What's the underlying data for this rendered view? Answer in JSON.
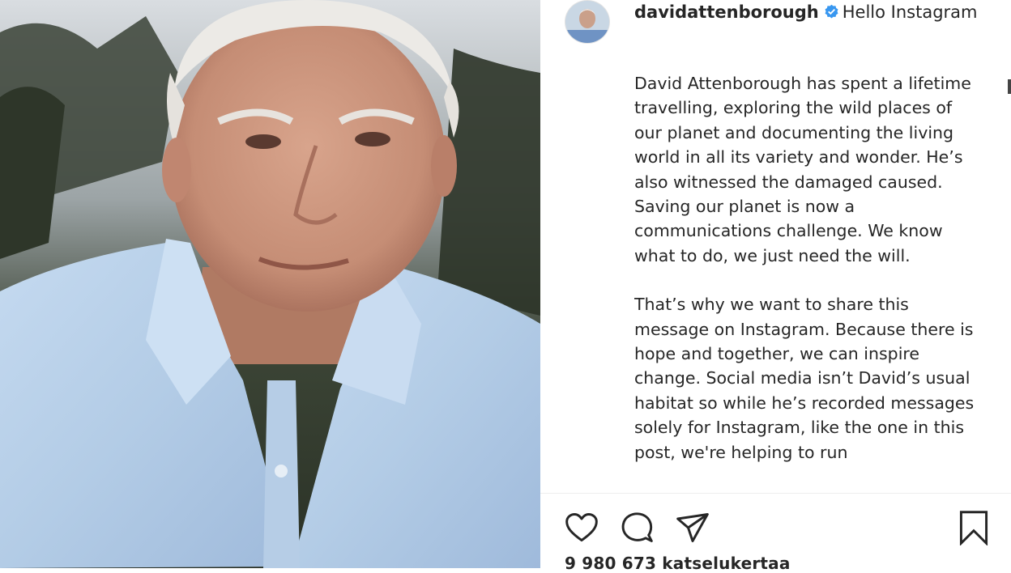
{
  "post": {
    "username": "davidattenborough",
    "header_text": "Hello Instagram",
    "caption_paragraphs": [
      "David Attenborough has spent a lifetime travelling, exploring the wild places of our planet and documenting the living world in all its variety and wonder. He’s also witnessed the damaged caused. Saving our planet is now a communications challenge. We know what to do, we just need the will.",
      "That’s why we want to share this message on Instagram. Because there is hope and together, we can inspire change. Social media isn’t David’s usual habitat so while he’s recorded messages solely for Instagram, like the one in this post, we're helping to run"
    ],
    "views_text": "9 980 673 katselukertaa"
  },
  "icons": {
    "verified": "verified-badge-icon",
    "like": "heart-icon",
    "comment": "comment-icon",
    "share": "paper-plane-icon",
    "save": "bookmark-icon"
  },
  "colors": {
    "verified_blue": "#3897f0",
    "text": "#262626",
    "shirt": "#b9d1ea"
  }
}
